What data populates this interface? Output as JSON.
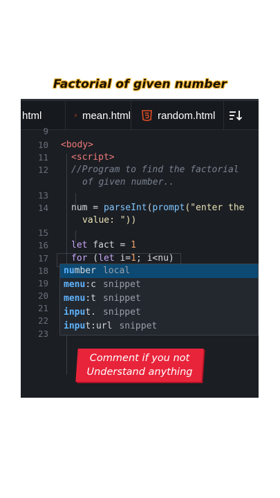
{
  "headline": "Factorial of given number",
  "tabs": [
    {
      "label": "html"
    },
    {
      "label": "mean.html"
    },
    {
      "label": "random.html"
    }
  ],
  "code_lines": [
    {
      "num": "9"
    },
    {
      "num": "10",
      "text": "<body>"
    },
    {
      "num": "11",
      "text": "<script>"
    },
    {
      "num": "12",
      "text": "//Program to find the factorial",
      "cont": "of given number.."
    },
    {
      "num": "13"
    },
    {
      "num": "14",
      "a": "num = ",
      "fn": "parseInt",
      "b": "(",
      "fn2": "prompt",
      "str": "(\"enter the",
      "cont": "value: \"))"
    },
    {
      "num": "15"
    },
    {
      "num": "16",
      "kw": "let",
      "rest": " fact = ",
      "n": "1"
    },
    {
      "num": "17",
      "kw": "for",
      "rest": " (",
      "kw2": "let",
      "rest2": " i=",
      "n": "1",
      "rest3": "; i<nu)"
    },
    {
      "num": "18"
    },
    {
      "num": "19"
    },
    {
      "num": "20"
    },
    {
      "num": "21"
    },
    {
      "num": "22"
    },
    {
      "num": "23"
    }
  ],
  "suggestions": [
    {
      "match": "nu",
      "rest": "mber",
      "kind": "local"
    },
    {
      "match": "menu",
      "rest": ":c",
      "kind": "snippet"
    },
    {
      "match": "menu",
      "rest": ":t",
      "kind": "snippet"
    },
    {
      "match": "inpu",
      "rest": "t.",
      "kind": "snippet"
    },
    {
      "match": "inpu",
      "rest": "t:url",
      "kind": "snippet"
    }
  ],
  "banner": {
    "line1": "Comment if you not",
    "line2": "Understand anything"
  },
  "colors": {
    "html_icon": "#e44d26",
    "selection": "#0d4a73",
    "banner": "#e8243a"
  }
}
